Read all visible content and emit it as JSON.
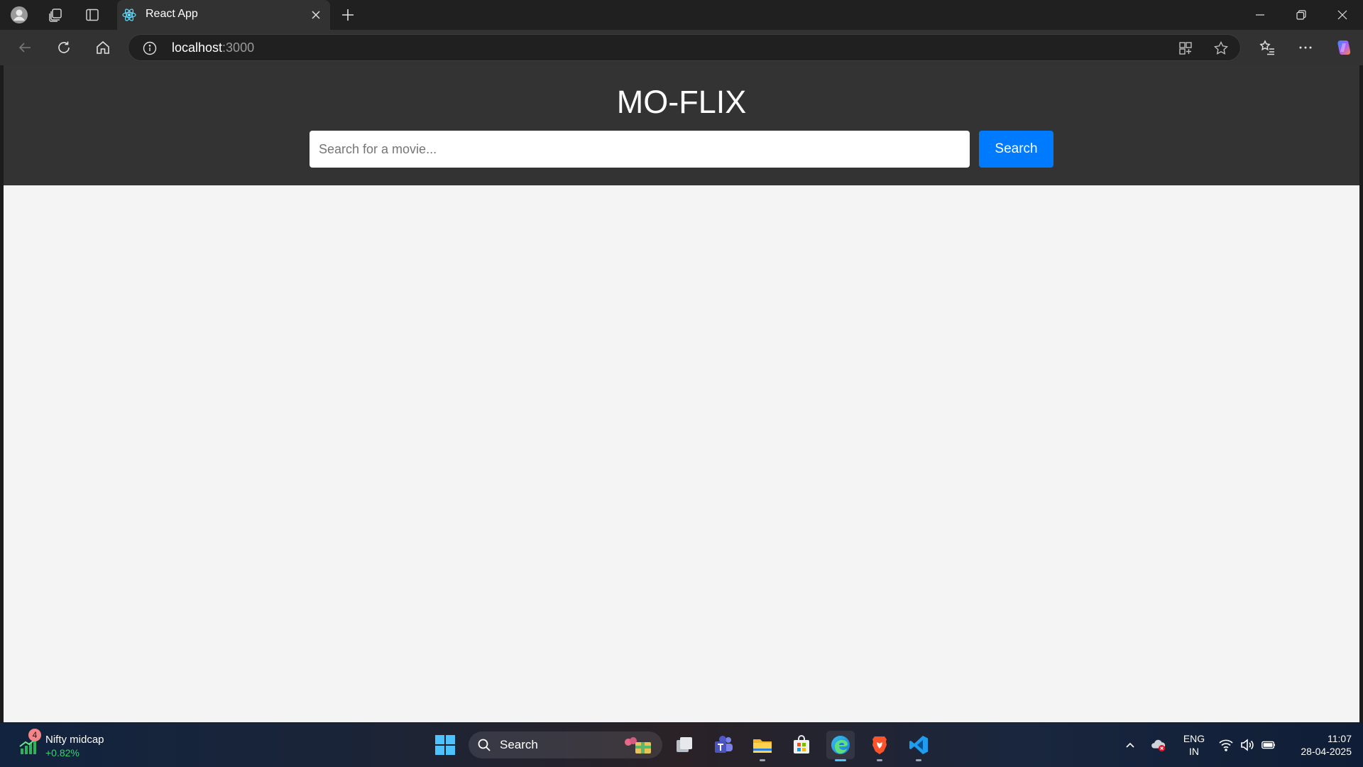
{
  "browser": {
    "tab_title": "React App",
    "address_host": "localhost",
    "address_port": ":3000"
  },
  "app": {
    "title": "MO-FLIX",
    "search_placeholder": "Search for a movie...",
    "search_button": "Search"
  },
  "taskbar": {
    "widget": {
      "badge": "4",
      "title": "Nifty midcap",
      "value": "+0.82%"
    },
    "search_label": "Search",
    "language_line1": "ENG",
    "language_line2": "IN",
    "time": "11:07",
    "date": "28-04-2025"
  },
  "colors": {
    "header_bg": "#333333",
    "page_bg": "#f4f4f4",
    "accent": "#007bff"
  }
}
